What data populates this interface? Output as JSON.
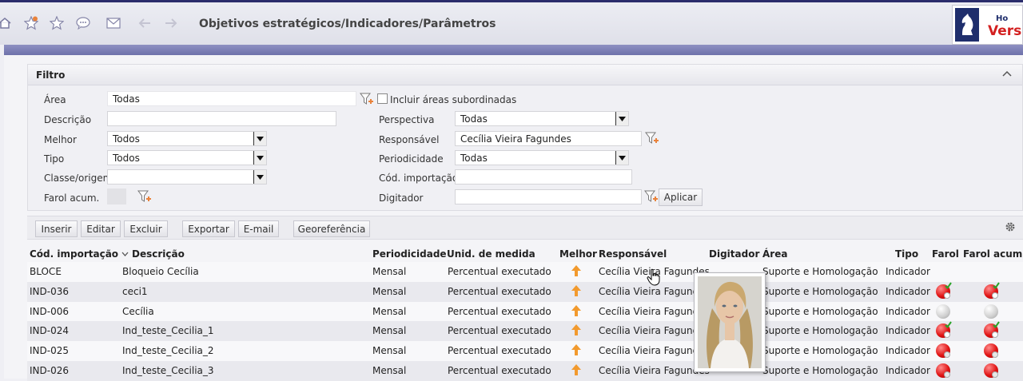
{
  "header": {
    "title": "Objetivos estratégicos/Indicadores/Parâmetros",
    "icons": [
      "home-icon",
      "favorite-add-icon",
      "favorite-icon",
      "chat-icon",
      "mail-icon",
      "back-arrow-icon",
      "forward-arrow-icon"
    ],
    "logo": {
      "top_text": "Ho",
      "main_text": "Versá"
    }
  },
  "filter": {
    "title": "Filtro",
    "area_label": "Área",
    "area_value": "Todas",
    "incluir_label": "Incluir áreas subordinadas",
    "descricao_label": "Descrição",
    "descricao_value": "",
    "melhor_label": "Melhor",
    "melhor_value": "Todos",
    "tipo_label": "Tipo",
    "tipo_value": "Todos",
    "classe_label": "Classe/origem",
    "classe_value": "",
    "farol_label": "Farol acum.",
    "perspectiva_label": "Perspectiva",
    "perspectiva_value": "Todas",
    "responsavel_label": "Responsável",
    "responsavel_value": "Cecília Vieira Fagundes",
    "periodicidade_label": "Periodicidade",
    "periodicidade_value": "Todas",
    "cod_importacao_label": "Cód. importação",
    "cod_importacao_value": "",
    "digitador_label": "Digitador",
    "digitador_value": "",
    "aplicar_label": "Aplicar"
  },
  "toolbar": {
    "inserir": "Inserir",
    "editar": "Editar",
    "excluir": "Excluir",
    "exportar": "Exportar",
    "email": "E-mail",
    "georeferencia": "Georeferência"
  },
  "grid": {
    "columns": {
      "cod": "Cód. importação",
      "descricao": "Descrição",
      "periodicidade": "Periodicidade",
      "unid": "Unid. de medida",
      "melhor": "Melhor",
      "responsavel": "Responsável",
      "digitador": "Digitador",
      "area": "Área",
      "tipo": "Tipo",
      "farol": "Farol",
      "farol_acum": "Farol acum."
    },
    "rows": [
      {
        "cod": "BLOCE",
        "descricao": "Bloqueio Cecília",
        "periodicidade": "Mensal",
        "unid": "Percentual executado",
        "melhor": "up",
        "responsavel": "Cecília Vieira Fagundes",
        "digitador": "",
        "area": "Suporte e Homologação",
        "tipo": "Indicador",
        "farol": "",
        "farol_acum": ""
      },
      {
        "cod": "IND-036",
        "descricao": "ceci1",
        "periodicidade": "Mensal",
        "unid": "Percentual executado",
        "melhor": "up",
        "responsavel": "Cecília Vieira Fagundes",
        "digitador": "",
        "area": "Suporte e Homologação",
        "tipo": "Indicador",
        "farol": "red-check",
        "farol_acum": "red-check"
      },
      {
        "cod": "IND-006",
        "descricao": "Cecília",
        "periodicidade": "Mensal",
        "unid": "Percentual executado",
        "melhor": "up",
        "responsavel": "Cecília Vieira Fagundes",
        "digitador": "",
        "area": "Suporte e Homologação",
        "tipo": "Indicador",
        "farol": "grey",
        "farol_acum": "grey"
      },
      {
        "cod": "IND-024",
        "descricao": "Ind_teste_Cecilia_1",
        "periodicidade": "Mensal",
        "unid": "Percentual executado",
        "melhor": "up",
        "responsavel": "Cecília Vieira Fagundes",
        "digitador": "",
        "area": "Suporte e Homologação",
        "tipo": "Indicador",
        "farol": "red-check",
        "farol_acum": "red-check"
      },
      {
        "cod": "IND-025",
        "descricao": "Ind_teste_Cecilia_2",
        "periodicidade": "Mensal",
        "unid": "Percentual executado",
        "melhor": "up",
        "responsavel": "Cecília Vieira Fagundes",
        "digitador": "",
        "area": "Suporte e Homologação",
        "tipo": "Indicador",
        "farol": "red-dot",
        "farol_acum": "red-dot"
      },
      {
        "cod": "IND-026",
        "descricao": "Ind_teste_Cecilia_3",
        "periodicidade": "Mensal",
        "unid": "Percentual executado",
        "melhor": "up",
        "responsavel": "Cecília Vieira Fagundes",
        "digitador": "",
        "area": "Suporte e Homologação",
        "tipo": "Indicador",
        "farol": "red-dot",
        "farol_acum": "red-dot"
      }
    ]
  },
  "popup": {
    "icon": "user-photo"
  }
}
